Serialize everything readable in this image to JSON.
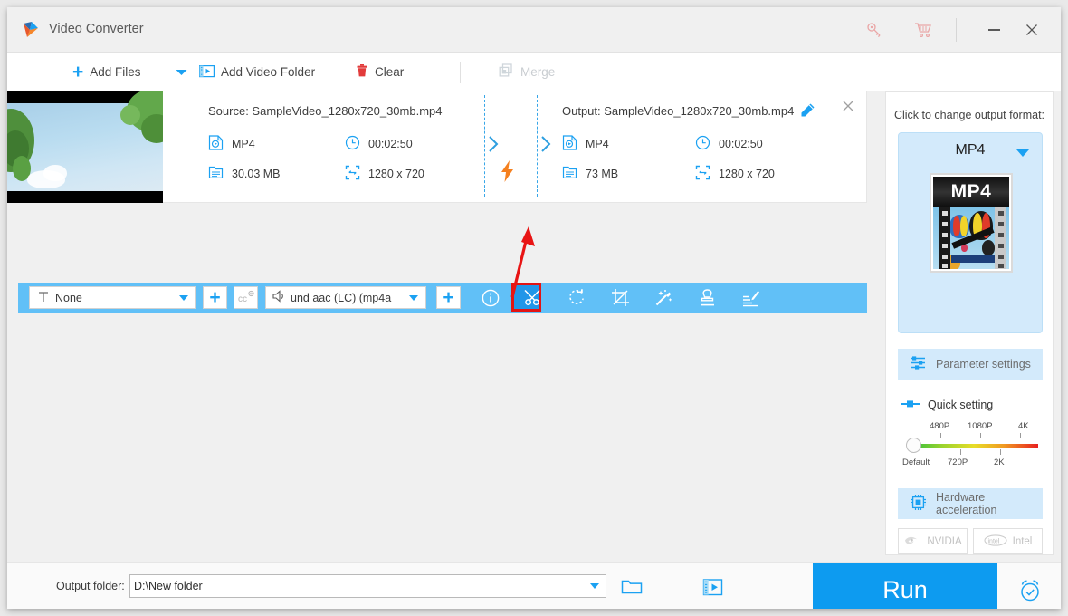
{
  "window": {
    "title": "Video Converter",
    "logo_icon": "app-logo-icon",
    "key_icon": "key-icon",
    "cart_icon": "shopping-cart-icon",
    "minimize_label": "minimize-icon",
    "close_label": "close-icon"
  },
  "menubar": {
    "add_files": "Add Files",
    "add_files_caret": "chevron-down-icon",
    "add_video_folder": "Add Video Folder",
    "clear": "Clear",
    "merge": "Merge"
  },
  "file_card": {
    "source_label": "Source: SampleVideo_1280x720_30mb.mp4",
    "output_label": "Output: SampleVideo_1280x720_30mb.mp4",
    "source": {
      "format": "MP4",
      "duration": "00:02:50",
      "size": "30.03 MB",
      "resolution": "1280 x 720"
    },
    "output": {
      "format": "MP4",
      "duration": "00:02:50",
      "size": "73 MB",
      "resolution": "1280 x 720"
    },
    "edit_icon": "pencil-edit-icon",
    "remove_icon": "close-icon",
    "convert_icon": "lightning-bolt-icon"
  },
  "toolbar": {
    "subtitle_value": "None",
    "audio_value": "und aac (LC) (mp4a",
    "add_subtitle_icon": "plus-icon",
    "cc_icon": "closed-caption-settings-icon",
    "add_audio_icon": "plus-icon",
    "tools": [
      {
        "name": "info-icon",
        "label": "Info"
      },
      {
        "name": "scissors-cut-icon",
        "label": "Cut"
      },
      {
        "name": "rotate-icon",
        "label": "Rotate"
      },
      {
        "name": "crop-icon",
        "label": "Crop"
      },
      {
        "name": "effects-wand-icon",
        "label": "Effect"
      },
      {
        "name": "watermark-stamp-icon",
        "label": "Watermark"
      },
      {
        "name": "subtitle-edit-icon",
        "label": "Subtitle"
      }
    ],
    "highlighted_tool": "scissors-cut-icon",
    "highlight_color": "#e21414"
  },
  "right_panel": {
    "format_prompt": "Click to change output format:",
    "format_name": "MP4",
    "format_thumb_label": "MP4",
    "parameter_settings": "Parameter settings",
    "quick_setting": "Quick setting",
    "slider": {
      "top_labels": [
        "480P",
        "1080P",
        "4K"
      ],
      "bottom_labels": [
        "Default",
        "720P",
        "2K"
      ],
      "value": "Default"
    },
    "hardware_acceleration": "Hardware acceleration",
    "gpu_options": [
      "NVIDIA",
      "Intel"
    ]
  },
  "bottom": {
    "output_folder_label": "Output folder:",
    "output_folder_value": "D:\\New folder",
    "open_folder_icon": "open-folder-icon",
    "file_list_icon": "video-list-icon",
    "run_label": "Run",
    "alarm_icon": "alarm-clock-icon"
  },
  "theme": {
    "accent": "#1ba1f2",
    "toolbar_blue": "#61c0f7",
    "run_blue": "#0d9bf0",
    "highlight_red": "#e21414",
    "panel_light_blue": "#d3eafb"
  }
}
